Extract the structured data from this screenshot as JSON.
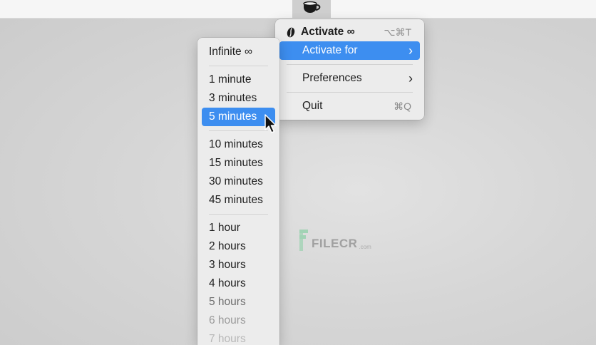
{
  "status_item": {
    "icon": "coffee-cup-icon"
  },
  "main_menu": {
    "activate": {
      "label": "Activate ∞",
      "shortcut": "⌥⌘T",
      "icon": "coffee-bean-icon"
    },
    "activate_for": {
      "label": "Activate for"
    },
    "preferences": {
      "label": "Preferences"
    },
    "quit": {
      "label": "Quit",
      "shortcut": "⌘Q"
    }
  },
  "submenu": {
    "infinite": "Infinite ∞",
    "minutes": [
      "1 minute",
      "3 minutes",
      "5 minutes",
      "10 minutes",
      "15 minutes",
      "30 minutes",
      "45 minutes"
    ],
    "hours": [
      "1 hour",
      "2 hours",
      "3 hours",
      "4 hours",
      "5 hours",
      "6 hours",
      "7 hours"
    ],
    "selected": "5 minutes"
  },
  "watermark": {
    "text": "FILECR",
    "domain": ".com"
  },
  "colors": {
    "highlight": "#3d8ef0",
    "menu_bg": "#ececec"
  }
}
